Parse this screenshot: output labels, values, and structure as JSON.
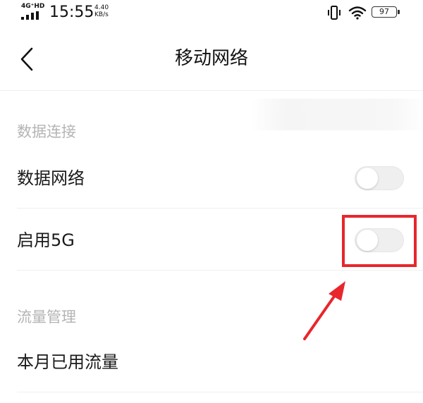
{
  "status_bar": {
    "network_type": "4G⁺HD",
    "time": "15:55",
    "speed_value": "4.40",
    "speed_unit": "KB/s",
    "battery_level": "97",
    "icons": [
      "signal-icon",
      "vibrate-icon",
      "wifi-icon",
      "battery-icon"
    ]
  },
  "header": {
    "back_icon": "chevron-left-icon",
    "title": "移动网络"
  },
  "sections": {
    "data_connection": {
      "title": "数据连接",
      "items": [
        {
          "label": "数据网络",
          "toggle_on": false
        },
        {
          "label": "启用5G",
          "toggle_on": false
        }
      ]
    },
    "traffic_management": {
      "title": "流量管理",
      "items": [
        {
          "label": "本月已用流量"
        }
      ]
    }
  },
  "colors": {
    "annotation_red": "#e8262c",
    "section_header": "#b4b4b4",
    "toggle_off": "#efefef"
  }
}
